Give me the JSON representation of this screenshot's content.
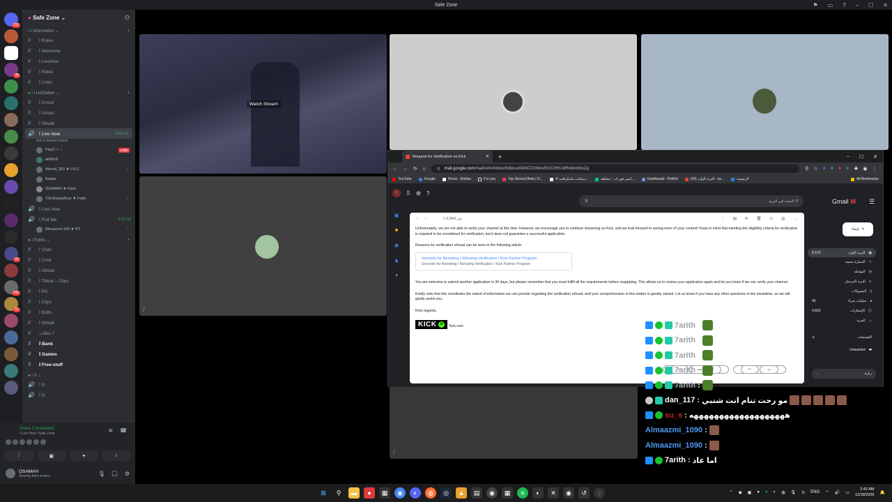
{
  "window": {
    "title": "Safe Zone"
  },
  "server": {
    "name": "Safe Zone",
    "rail_badges": [
      "232",
      "38",
      "92",
      "343",
      "51"
    ]
  },
  "channels": {
    "cat_information": "ا Information",
    "info": [
      "ا Rules",
      "ا Welcome",
      "ا LiveNow",
      "ا Roles",
      "ا Links"
    ],
    "cat_livestation": "ا LiveStation",
    "livestation": [
      "ا Cmod",
      "ا Umod",
      "ا Streak"
    ],
    "live_now": {
      "name": "ا Live Now",
      "time": "4:01:25",
      "status": "Set a channel status"
    },
    "live_users": [
      {
        "name": "Play2 ✧ ⋆",
        "live": "LIVE"
      },
      {
        "name": "a6d0c8"
      },
      {
        "name": "Abood_350 ★ LVL1"
      },
      {
        "name": "Badas"
      },
      {
        "name": "OSAMAH ★ Fade"
      },
      {
        "name": "TheSleepyBear ★ Fade"
      }
    ],
    "live_now2": "ا Live Now",
    "pull_me": {
      "name": "ا Pull Me",
      "time": "2:01:30"
    },
    "pull_users": [
      {
        "name": "Almaazmi-109 ★ BT"
      }
    ],
    "cat_public": "ا Public",
    "public": [
      "ا Chat",
      "ا Cmd",
      "ا Athkar",
      "ا Tiktok – Clips",
      "ا Pic",
      "ا Clips",
      "ا Edits",
      "ا Streak",
      "ا عائلات"
    ],
    "collapsed": [
      "ا Bank",
      "ا Games",
      "ا Free-stuff"
    ],
    "cat_v": "ا V",
    "v_channels": [
      "ا G",
      "ا G"
    ]
  },
  "voice": {
    "connected": "Voice Connected",
    "location": "ا Live Now / Safe Zone"
  },
  "user": {
    "name": "OSAMAH",
    "status": "Sharing their screen"
  },
  "stage": {
    "watch_stream": "Watch Stream"
  },
  "browser": {
    "tab_title": "Request for Verification on Kick",
    "url_host": "mail.google.com",
    "url_path": "/mail/u/4/#inbox/KtbxLwGkNCDXMnxfSXCHHLMRvkbmfxsZg",
    "bookmarks": [
      "YouTube",
      "Google",
      "Home - Roblox",
      "For you",
      "Top Discord Bots | D...",
      "سكنات ماينكرافت الا...",
      "انمي فور اب - مشاهد...",
      "Dashboard - ProBot",
      "(43) الترند الوارد - os...",
      "الرئيسية"
    ],
    "all_bookmarks": "All Bookmarks"
  },
  "gmail": {
    "search_placeholder": "البحث في البريد",
    "logo": "Gmail",
    "email_count": "1 من 5,844",
    "para1": "Unfortunately, we are not able to verify your channel at this time. However, we encourage you to continue streaming on Kick, and we look forward to seeing more of your content! Keep in mind that meeting the eligibility criteria for verification is required to be considered for verification, but it does not guarantee a successful application.",
    "para2": "Reasons for verification refusal can be seen in the following article:",
    "link1": "Grounds for Revoking / Refusing Verification / Kick Partner Program",
    "link2": "Grounds for Revoking / Refusing Verification / Kick Partner Program",
    "para3": "You are welcome to submit another application in 30 days, but please remember that you must fulfill all the requirements before reapplying. This allows us to review your application again and let you know if we can verify your channel.",
    "para4": "Kindly note that this constitutes the extent of information we can provide regarding the verification refusal, and your comprehension in this matter is greatly valued. Let us know if you have any other questions in the meantime, as we will gladly assist you.",
    "regards": "Kind regards,",
    "kick_logo": "KICK",
    "kick_site": "Kick.com",
    "reply": "رد",
    "forward": "إعادة توجيه",
    "compose": "إنشاء",
    "nav": [
      {
        "label": "البريد الوارد",
        "count": "8,575"
      },
      {
        "label": "المميّزة بنجمة",
        "count": ""
      },
      {
        "label": "المؤجلة",
        "count": ""
      },
      {
        "label": "البريد المرسل",
        "count": ""
      },
      {
        "label": "المسودّات",
        "count": ""
      },
      {
        "label": "عمليات شراء",
        "count": "46"
      },
      {
        "label": "الإشعارات",
        "count": "4,602"
      },
      {
        "label": "المزيد",
        "count": ""
      }
    ],
    "labels_title": "التصنيفات",
    "unwanted": "Unwanted",
    "visit": "زيارة"
  },
  "chat": [
    {
      "user": "7arith",
      "color": "#9aa0a6",
      "text": "",
      "badges": 3
    },
    {
      "user": "7arith",
      "color": "#9aa0a6",
      "text": "",
      "badges": 3
    },
    {
      "user": "7arith",
      "color": "#9aa0a6",
      "text": "",
      "badges": 3
    },
    {
      "user": "7arith",
      "color": "#9aa0a6",
      "text": "",
      "badges": 3
    },
    {
      "user": "7arith",
      "color": "#9aa0a6",
      "text": "",
      "badges": 3
    },
    {
      "user": "dan_117",
      "color": "#ffffff",
      "text": "مو رحت تنام انت شنبي",
      "badges": 2
    },
    {
      "user": "su_s",
      "color": "#cc2222",
      "text": "هههههههههههههههههههه",
      "badges": 2
    },
    {
      "user": "Almaazmi_1090",
      "color": "#4f9bf5",
      "text": "",
      "badges": 0
    },
    {
      "user": "Almaazmi_1090",
      "color": "#4f9bf5",
      "text": "",
      "badges": 0
    },
    {
      "user": "7arith",
      "color": "#ffffff",
      "text": "اما عاد",
      "badges": 2
    }
  ],
  "taskbar": {
    "lang": "ENG",
    "time": "2:42 AM",
    "date": "12/18/2025"
  }
}
